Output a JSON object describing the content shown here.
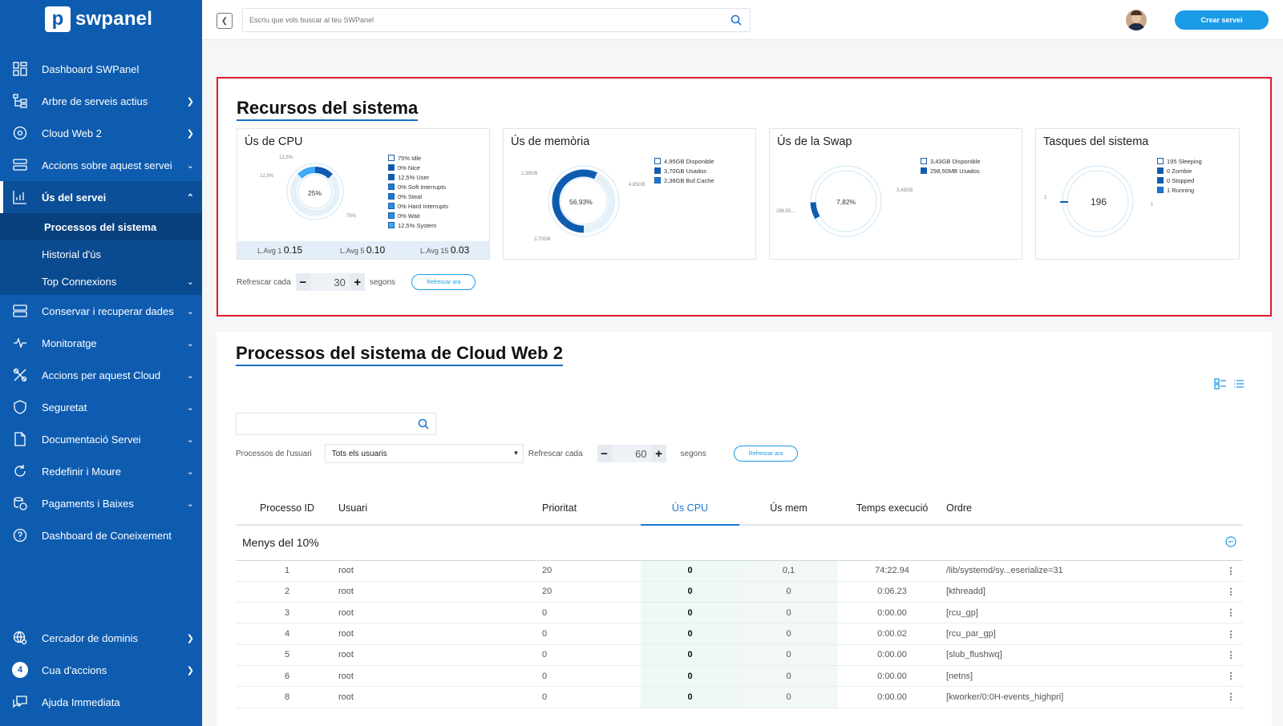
{
  "app": {
    "logo_letter": "p",
    "logo_text": "swpanel"
  },
  "sidebar": {
    "items": [
      {
        "label": "Dashboard SWPanel",
        "icon": "dashboard-grid-icon"
      },
      {
        "label": "Arbre de serveis actius",
        "icon": "tree-icon"
      },
      {
        "label": "Cloud Web 2",
        "icon": "cloud-target-icon"
      },
      {
        "label": "Accions sobre aquest servei",
        "icon": "server-actions-icon"
      },
      {
        "label": "Ús del servei",
        "icon": "bar-chart-icon"
      }
    ],
    "subitems": [
      {
        "label": "Processos del sistema"
      },
      {
        "label": "Historial d'ús"
      },
      {
        "label": "Top Connexions"
      }
    ],
    "items2": [
      {
        "label": "Conservar i recuperar dades",
        "icon": "database-icon"
      },
      {
        "label": "Monitoratge",
        "icon": "pulse-icon"
      },
      {
        "label": "Accions per aquest Cloud",
        "icon": "tools-icon"
      },
      {
        "label": "Seguretat",
        "icon": "shield-icon"
      },
      {
        "label": "Documentació Servei",
        "icon": "document-icon"
      },
      {
        "label": "Redefinir i Moure",
        "icon": "redefine-icon"
      },
      {
        "label": "Pagaments i Baixes",
        "icon": "payments-icon"
      },
      {
        "label": "Dashboard de Coneixement",
        "icon": "help-circle-icon"
      }
    ],
    "bottom": [
      {
        "label": "Cercador de dominis",
        "icon": "globe-search-icon"
      },
      {
        "label": "Cua d'accions",
        "badge": "4"
      },
      {
        "label": "Ajuda Immediata",
        "icon": "chat-icon"
      }
    ]
  },
  "topbar": {
    "search_placeholder": "Escriu que vols buscar al teu SWPanel",
    "create_button": "Crear servei"
  },
  "resources": {
    "title": "Recursos del sistema",
    "cpu": {
      "title": "Ús de CPU",
      "center": "25%",
      "labels": {
        "top": "12,5%",
        "left": "12,5%",
        "bottom": "75%"
      },
      "legend": [
        "75% Idle",
        "0% Nice",
        "12,5% User",
        "0% Soft Interrupts",
        "0% Steal",
        "0% Hard Interrupts",
        "0% Wait",
        "12,5% System"
      ],
      "lavg": [
        {
          "label": "L.Avg 1",
          "value": "0.15"
        },
        {
          "label": "L.Avg 5",
          "value": "0.10"
        },
        {
          "label": "L.Avg 15",
          "value": "0.03"
        }
      ]
    },
    "memory": {
      "title": "Ús de memòria",
      "center": "56,93%",
      "labels": {
        "left": "2,38GB",
        "right": "4,95GB",
        "bottom": "3,70GB"
      },
      "legend": [
        "4,95GB Disponible",
        "3,70GB Usados",
        "2,38GB Buf.Cache"
      ]
    },
    "swap": {
      "title": "Ús de la Swap",
      "center": "7,82%",
      "labels": {
        "right": "3,43GB",
        "left": "298,50..."
      },
      "legend": [
        "3,43GB Disponible",
        "298,50MB Usados"
      ]
    },
    "tasks": {
      "title": "Tasques del sistema",
      "center": "196",
      "labels": {
        "left": "1",
        "right": "1"
      },
      "legend": [
        "195 Sleeping",
        "0 Zombie",
        "0 Stopped",
        "1 Running"
      ]
    },
    "refresh": {
      "label": "Refrescar cada",
      "value": "30",
      "unit": "segons",
      "button": "Refrescar ara"
    }
  },
  "processes": {
    "title": "Processos del sistema de Cloud Web 2",
    "filter_label": "Processos de l'usuari",
    "filter_value": "Tots els usuaris",
    "refresh": {
      "label": "Refrescar cada",
      "value": "60",
      "unit": "segons",
      "button": "Refrescar ara"
    },
    "columns": [
      "Processo ID",
      "Usuari",
      "Prioritat",
      "Ús CPU",
      "Ús mem",
      "Temps execució",
      "Ordre"
    ],
    "group": "Menys del 10%",
    "rows": [
      {
        "pid": "1",
        "user": "root",
        "prio": "20",
        "cpu": "0",
        "mem": "0,1",
        "time": "74:22.94",
        "cmd": "/lib/systemd/sy...eserialize=31"
      },
      {
        "pid": "2",
        "user": "root",
        "prio": "20",
        "cpu": "0",
        "mem": "0",
        "time": "0:06.23",
        "cmd": "[kthreadd]"
      },
      {
        "pid": "3",
        "user": "root",
        "prio": "0",
        "cpu": "0",
        "mem": "0",
        "time": "0:00.00",
        "cmd": "[rcu_gp]"
      },
      {
        "pid": "4",
        "user": "root",
        "prio": "0",
        "cpu": "0",
        "mem": "0",
        "time": "0:00.02",
        "cmd": "[rcu_par_gp]"
      },
      {
        "pid": "5",
        "user": "root",
        "prio": "0",
        "cpu": "0",
        "mem": "0",
        "time": "0:00.00",
        "cmd": "[slub_flushwq]"
      },
      {
        "pid": "6",
        "user": "root",
        "prio": "0",
        "cpu": "0",
        "mem": "0",
        "time": "0:00.00",
        "cmd": "[netns]"
      },
      {
        "pid": "8",
        "user": "root",
        "prio": "0",
        "cpu": "0",
        "mem": "0",
        "time": "0:00.00",
        "cmd": "[kworker/0:0H-events_highpri]"
      }
    ]
  },
  "colors": {
    "sidebar": "#0e5cb0",
    "accent": "#1a9be6",
    "highlight_border": "#e21b23",
    "donut": "#0e5cb0",
    "donut_light": "#3fa9f5"
  }
}
